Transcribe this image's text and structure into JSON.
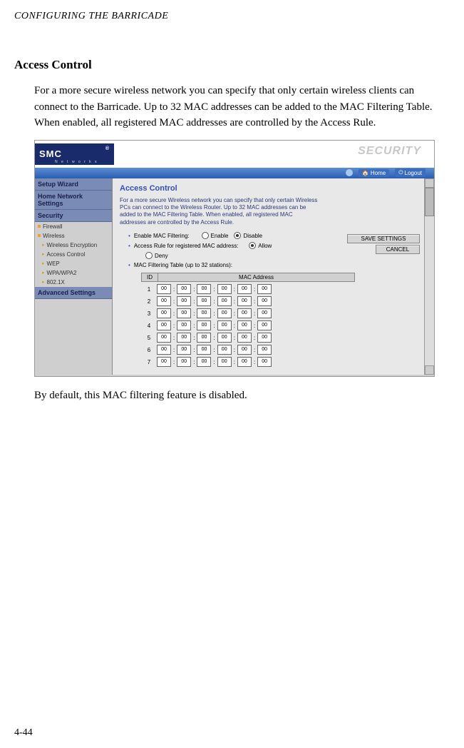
{
  "doc": {
    "running_head": "CONFIGURING THE BARRICADE",
    "section_title": "Access Control",
    "intro": "For a more secure wireless network you can specify that only certain wireless clients can connect to the Barricade. Up to 32 MAC addresses can be added to the MAC Filtering Table. When enabled, all registered MAC addresses are controlled by the Access Rule.",
    "outro": "By default, this MAC filtering feature is disabled.",
    "page_num": "4-44"
  },
  "ui": {
    "logo": "SMC",
    "logo_sub": "N e t w o r k s",
    "logo_r": "®",
    "security_label": "SECURITY",
    "topbar": {
      "home": "Home",
      "logout": "Logout"
    },
    "sidebar": {
      "setup_wizard": "Setup Wizard",
      "home_network": "Home Network Settings",
      "security": "Security",
      "firewall": "Firewall",
      "wireless": "Wireless",
      "items": [
        "Wireless Encryption",
        "Access Control",
        "WEP",
        "WPA/WPA2",
        "802.1X"
      ],
      "advanced": "Advanced Settings"
    },
    "content": {
      "title": "Access Control",
      "desc": "For a more secure Wireless network you can specify that only certain Wireless PCs can connect to the Wireless Router. Up to 32 MAC addresses can be added to the MAC Filtering Table. When enabled, all registered MAC addresses are controlled by the Access Rule.",
      "enable_label": "Enable MAC Filtering:",
      "enable_opt": "Enable",
      "disable_opt": "Disable",
      "access_rule_label": "Access Rule for registered MAC address:",
      "allow_opt": "Allow",
      "deny_opt": "Deny",
      "table_label": "MAC Filtering Table (up to 32 stations):",
      "save_btn": "SAVE SETTINGS",
      "cancel_btn": "CANCEL",
      "table": {
        "id_hdr": "ID",
        "addr_hdr": "MAC Address",
        "rows": [
          1,
          2,
          3,
          4,
          5,
          6,
          7
        ],
        "cell_val": "00"
      }
    }
  }
}
